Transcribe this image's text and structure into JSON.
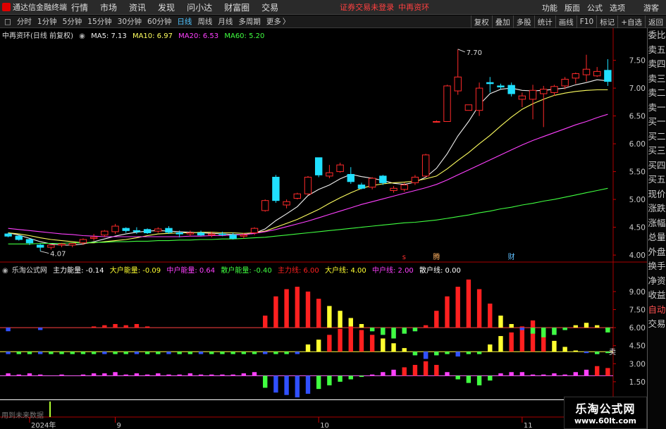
{
  "menubar": {
    "app_title": "通达信金融终端",
    "items": [
      "行情",
      "市场",
      "资讯",
      "发现",
      "问小达",
      "财富圈",
      "交易"
    ],
    "login_warning": "证券交易未登录",
    "stock_name": "中再资环",
    "right_items": [
      "功能",
      "版面",
      "公式",
      "选项"
    ],
    "user": "游客"
  },
  "tabs": {
    "left_glyph": "□",
    "items": [
      "分时",
      "1分钟",
      "5分钟",
      "15分钟",
      "30分钟",
      "60分钟",
      "日线",
      "周线",
      "月线",
      "多周期",
      "更多"
    ],
    "active": "日线",
    "more_glyph": "〉",
    "right_items": [
      "复权",
      "叠加",
      "多股",
      "统计",
      "画线",
      "F10",
      "标记",
      "+自选",
      "返回"
    ]
  },
  "sidebar": [
    "委比",
    "卖五",
    "卖四",
    "卖三",
    "卖二",
    "卖一",
    "买一",
    "买二",
    "买三",
    "买四",
    "买五",
    "现价",
    "涨跌",
    "涨幅",
    "总量",
    "外盘",
    "换手",
    "净资",
    "收益",
    "自动",
    "交易"
  ],
  "colors": {
    "up": "#ff2a2a",
    "down": "#20e0ff",
    "ma5": "#f0f0f0",
    "ma10": "#ffff60",
    "ma20": "#ff40ff",
    "ma60": "#40ff40",
    "main_force": "#ff2020",
    "big_house": "#ffff30",
    "mid_house": "#3050ff",
    "retail": "#40ff40"
  },
  "main_legend": {
    "title": "中再资环(日线 前复权)",
    "ma": [
      {
        "label": "MA5: 7.13",
        "color": "#f0f0f0"
      },
      {
        "label": "MA10: 6.97",
        "color": "#ffff60"
      },
      {
        "label": "MA20: 6.53",
        "color": "#ff40ff"
      },
      {
        "label": "MA60: 5.20",
        "color": "#40ff40"
      }
    ]
  },
  "ind_legend": {
    "title": "乐淘公式网",
    "items": [
      {
        "label": "主力能量: -0.14",
        "color": "#ffffff"
      },
      {
        "label": "大户能量: -0.09",
        "color": "#ffff30"
      },
      {
        "label": "中户能量: 0.64",
        "color": "#ff40ff"
      },
      {
        "label": "散户能量: -0.40",
        "color": "#40ff40"
      },
      {
        "label": "主力线: 6.00",
        "color": "#ff2020"
      },
      {
        "label": "大户线: 4.00",
        "color": "#ffff30"
      },
      {
        "label": "中户线: 2.00",
        "color": "#ff40ff"
      },
      {
        "label": "散户线: 0.00",
        "color": "#ffffff"
      }
    ]
  },
  "annotations": {
    "high": "7.70",
    "low": "4.07",
    "marker_s": "s",
    "marker_a": "腾",
    "marker_b": "财",
    "right_tag": "卖"
  },
  "footer_note": "用到未来数据",
  "watermark": {
    "name": "乐淘公式网",
    "url": "www.60lt.com"
  },
  "chart_data": [
    {
      "type": "candlestick",
      "name": "price",
      "ylim": [
        3.9,
        7.9
      ],
      "yticks": [
        4.0,
        4.5,
        5.0,
        5.5,
        6.0,
        6.5,
        7.0,
        7.5
      ],
      "x_labels": [
        "2024年",
        "9",
        "10",
        "11"
      ],
      "x_label_index": [
        2,
        10,
        29,
        48
      ],
      "candles": [
        [
          4.38,
          4.4,
          4.32,
          4.34
        ],
        [
          4.34,
          4.36,
          4.26,
          4.28
        ],
        [
          4.28,
          4.3,
          4.18,
          4.22
        ],
        [
          4.18,
          4.2,
          4.07,
          4.14
        ],
        [
          4.14,
          4.2,
          4.1,
          4.18
        ],
        [
          4.18,
          4.22,
          4.14,
          4.2
        ],
        [
          4.18,
          4.22,
          4.14,
          4.21
        ],
        [
          4.22,
          4.3,
          4.18,
          4.28
        ],
        [
          4.3,
          4.38,
          4.26,
          4.32
        ],
        [
          4.36,
          4.45,
          4.32,
          4.43
        ],
        [
          4.42,
          4.56,
          4.38,
          4.52
        ],
        [
          4.48,
          4.5,
          4.4,
          4.44
        ],
        [
          4.44,
          4.5,
          4.38,
          4.42
        ],
        [
          4.46,
          4.48,
          4.38,
          4.4
        ],
        [
          4.43,
          4.5,
          4.4,
          4.47
        ],
        [
          4.48,
          4.52,
          4.38,
          4.41
        ],
        [
          4.4,
          4.44,
          4.32,
          4.38
        ],
        [
          4.38,
          4.44,
          4.34,
          4.4
        ],
        [
          4.4,
          4.44,
          4.34,
          4.36
        ],
        [
          4.36,
          4.42,
          4.32,
          4.38
        ],
        [
          4.38,
          4.42,
          4.34,
          4.37
        ],
        [
          4.36,
          4.4,
          4.28,
          4.3
        ],
        [
          4.34,
          4.4,
          4.3,
          4.36
        ],
        [
          4.4,
          4.5,
          4.36,
          4.48
        ],
        [
          4.8,
          5.0,
          4.78,
          4.98
        ],
        [
          5.4,
          5.44,
          4.94,
          4.98
        ],
        [
          4.9,
          5.0,
          4.84,
          4.96
        ],
        [
          5.02,
          5.12,
          5.0,
          5.1
        ],
        [
          5.1,
          5.42,
          5.08,
          5.4
        ],
        [
          5.75,
          5.75,
          5.4,
          5.44
        ],
        [
          5.42,
          5.62,
          5.38,
          5.48
        ],
        [
          5.5,
          5.66,
          5.48,
          5.62
        ],
        [
          5.45,
          5.58,
          5.28,
          5.32
        ],
        [
          5.26,
          5.3,
          5.18,
          5.2
        ],
        [
          5.22,
          5.4,
          5.18,
          5.38
        ],
        [
          5.42,
          5.44,
          5.26,
          5.3
        ],
        [
          5.16,
          5.24,
          5.12,
          5.2
        ],
        [
          5.18,
          5.3,
          5.14,
          5.26
        ],
        [
          5.3,
          5.44,
          5.26,
          5.4
        ],
        [
          5.42,
          5.82,
          5.4,
          5.8
        ],
        [
          6.4,
          6.42,
          6.38,
          6.4
        ],
        [
          6.4,
          7.06,
          6.4,
          7.04
        ],
        [
          6.95,
          7.7,
          6.88,
          7.2
        ],
        [
          6.6,
          6.62,
          6.7,
          6.7
        ],
        [
          6.6,
          7.1,
          6.5,
          7.0
        ],
        [
          7.1,
          7.2,
          6.92,
          7.08
        ],
        [
          7.04,
          7.08,
          6.98,
          7.02
        ],
        [
          7.05,
          7.1,
          6.85,
          6.9
        ],
        [
          6.8,
          6.92,
          6.66,
          6.86
        ],
        [
          6.8,
          7.06,
          6.44,
          6.96
        ],
        [
          6.9,
          7.04,
          6.3,
          6.98
        ],
        [
          6.92,
          7.06,
          6.86,
          7.03
        ],
        [
          7.04,
          7.2,
          6.98,
          7.16
        ],
        [
          7.18,
          7.28,
          7.08,
          7.26
        ],
        [
          7.24,
          7.6,
          7.12,
          7.34
        ],
        [
          7.22,
          7.38,
          7.2,
          7.3
        ],
        [
          7.32,
          7.52,
          7.04,
          7.12
        ]
      ],
      "ma": {
        "ma5": [
          4.4,
          4.36,
          4.3,
          4.24,
          4.2,
          4.18,
          4.18,
          4.2,
          4.24,
          4.29,
          4.34,
          4.38,
          4.41,
          4.43,
          4.44,
          4.43,
          4.42,
          4.41,
          4.4,
          4.39,
          4.38,
          4.37,
          4.37,
          4.39,
          4.47,
          4.62,
          4.74,
          4.87,
          5.07,
          5.18,
          5.26,
          5.37,
          5.45,
          5.41,
          5.38,
          5.34,
          5.29,
          5.27,
          5.31,
          5.4,
          5.56,
          5.82,
          6.14,
          6.4,
          6.7,
          6.9,
          6.98,
          7.0,
          6.96,
          6.95,
          6.96,
          6.98,
          7.0,
          7.06,
          7.1,
          7.15,
          7.13
        ],
        "ma10": [
          4.4,
          4.38,
          4.35,
          4.31,
          4.28,
          4.26,
          4.24,
          4.22,
          4.22,
          4.24,
          4.26,
          4.28,
          4.31,
          4.35,
          4.38,
          4.39,
          4.4,
          4.4,
          4.41,
          4.41,
          4.4,
          4.4,
          4.39,
          4.4,
          4.43,
          4.5,
          4.57,
          4.64,
          4.73,
          4.82,
          4.93,
          5.03,
          5.12,
          5.2,
          5.25,
          5.28,
          5.3,
          5.31,
          5.33,
          5.37,
          5.42,
          5.55,
          5.7,
          5.84,
          6.0,
          6.15,
          6.32,
          6.48,
          6.62,
          6.72,
          6.8,
          6.87,
          6.91,
          6.94,
          6.96,
          6.97,
          6.97
        ],
        "ma20": [
          4.48,
          4.46,
          4.44,
          4.42,
          4.4,
          4.38,
          4.37,
          4.35,
          4.34,
          4.33,
          4.33,
          4.33,
          4.33,
          4.33,
          4.33,
          4.33,
          4.33,
          4.34,
          4.34,
          4.35,
          4.35,
          4.36,
          4.37,
          4.39,
          4.42,
          4.46,
          4.51,
          4.56,
          4.61,
          4.67,
          4.73,
          4.79,
          4.85,
          4.91,
          4.96,
          5.01,
          5.06,
          5.11,
          5.16,
          5.21,
          5.27,
          5.35,
          5.44,
          5.53,
          5.62,
          5.71,
          5.8,
          5.89,
          5.98,
          6.06,
          6.13,
          6.2,
          6.27,
          6.34,
          6.4,
          6.47,
          6.53
        ],
        "ma60": [
          4.2,
          4.2,
          4.2,
          4.21,
          4.21,
          4.21,
          4.22,
          4.22,
          4.23,
          4.23,
          4.24,
          4.24,
          4.25,
          4.25,
          4.26,
          4.26,
          4.27,
          4.27,
          4.28,
          4.28,
          4.29,
          4.29,
          4.3,
          4.31,
          4.32,
          4.34,
          4.36,
          4.38,
          4.4,
          4.42,
          4.44,
          4.46,
          4.48,
          4.5,
          4.52,
          4.54,
          4.56,
          4.58,
          4.59,
          4.61,
          4.63,
          4.66,
          4.69,
          4.72,
          4.76,
          4.79,
          4.83,
          4.86,
          4.9,
          4.93,
          4.97,
          5.0,
          5.04,
          5.08,
          5.12,
          5.16,
          5.2
        ]
      }
    },
    {
      "type": "bar",
      "name": "indicator",
      "ylim": [
        -1.2,
        10.4
      ],
      "yticks": [
        9.0,
        7.5,
        6.0,
        4.5,
        3.0,
        1.5
      ],
      "baselines": [
        {
          "value": 6,
          "color": "#ff4040"
        },
        {
          "value": 4,
          "color": "#ffff40"
        },
        {
          "value": 2,
          "color": "#ff60ff"
        },
        {
          "value": 0,
          "color": "#ffffff"
        }
      ],
      "series": [
        {
          "name": "主力能量",
          "baseline": 6,
          "values": [
            0,
            0,
            0,
            0,
            0,
            0,
            0,
            0,
            0.1,
            0.2,
            0.3,
            0.2,
            0.3,
            0.1,
            0,
            0,
            0,
            0,
            0,
            0,
            0,
            0,
            0,
            0,
            1.0,
            2.6,
            3.2,
            3.4,
            3.0,
            2.4,
            1.8,
            1.4,
            0.8,
            0.3,
            -0.3,
            -0.6,
            -0.9,
            -0.5,
            -0.3,
            0.2,
            1.4,
            2.6,
            3.4,
            4.0,
            3.2,
            2.0,
            1.0,
            0.3,
            -0.2,
            -0.5,
            -0.8,
            -0.6,
            -0.2,
            0.2,
            0.4,
            0.2,
            -0.14
          ]
        },
        {
          "name": "大户能量",
          "baseline": 4,
          "values": [
            0,
            0,
            0,
            0,
            0,
            0,
            0,
            0,
            0,
            0,
            0,
            0,
            0,
            0,
            0,
            0,
            0,
            0,
            0,
            0,
            0,
            0,
            0,
            0,
            0,
            0,
            0,
            0,
            0.6,
            1.0,
            1.4,
            1.9,
            2.1,
            1.8,
            1.4,
            1.1,
            0.7,
            0.3,
            -0.3,
            -0.6,
            -0.3,
            0,
            0,
            0,
            0,
            0.6,
            1.3,
            1.6,
            2.1,
            2.6,
            1.8,
            0.9,
            0.4,
            0.1,
            -0.1,
            -0.2,
            -0.09
          ]
        },
        {
          "name": "中户能量",
          "baseline": 2,
          "values": [
            0.2,
            0.1,
            0.2,
            0.1,
            0,
            0.1,
            0,
            0.1,
            0.2,
            0.2,
            0.3,
            0.1,
            0.2,
            0.1,
            0.2,
            0.1,
            0.1,
            0.2,
            0.1,
            0.1,
            0.1,
            0.1,
            0.2,
            0.3,
            -1.0,
            -1.4,
            -1.6,
            -1.8,
            -1.5,
            -1.1,
            -0.8,
            -0.5,
            -0.3,
            -0.1,
            0.1,
            0.3,
            0.5,
            0.7,
            0.9,
            1.2,
            0.9,
            0.3,
            -0.3,
            -0.6,
            -0.8,
            -0.4,
            0.2,
            0.3,
            0.3,
            0.1,
            0.1,
            0.2,
            0.1,
            0.3,
            0.5,
            0.8,
            0.64
          ]
        },
        {
          "name": "散户能量",
          "baseline": 6,
          "values": [
            0,
            0,
            0,
            0,
            0,
            0,
            0,
            0,
            0,
            0,
            0,
            0,
            0,
            0,
            0,
            0,
            0,
            0,
            0,
            0,
            0,
            0,
            0,
            0,
            0,
            0,
            0,
            0,
            0,
            0,
            0,
            0,
            0,
            0,
            0,
            0,
            0,
            0,
            0,
            0,
            0,
            0,
            0,
            0,
            0,
            0,
            0,
            0,
            0,
            0,
            0,
            0,
            0,
            0,
            0,
            0,
            -0.4
          ]
        }
      ],
      "baseline_marks": [
        {
          "baseline": 6,
          "values": [
            -0.3,
            0,
            0,
            -0.2,
            0,
            0,
            0,
            0,
            0,
            0,
            0,
            0,
            0,
            0,
            0,
            0,
            0,
            0,
            0,
            0,
            0,
            0,
            0,
            0,
            0,
            0,
            0,
            0,
            0,
            0,
            0,
            0,
            0,
            0,
            -0.3,
            -0.6,
            -0.9,
            -0.5,
            -0.3,
            0,
            0,
            0,
            0,
            0,
            0,
            0,
            0,
            0,
            -0.2,
            -0.5,
            -0.8,
            -0.6,
            -0.2,
            0,
            0,
            0,
            -0.14
          ]
        },
        {
          "baseline": 4,
          "values": [
            -0.2,
            -0.2,
            -0.2,
            -0.2,
            -0.2,
            -0.2,
            -0.2,
            -0.2,
            -0.2,
            -0.2,
            -0.2,
            -0.2,
            -0.2,
            -0.2,
            -0.2,
            -0.2,
            -0.2,
            -0.2,
            -0.2,
            -0.2,
            -0.2,
            -0.2,
            -0.2,
            -0.2,
            -0.2,
            -0.2,
            -0.2,
            -0.2,
            0,
            0,
            0,
            0,
            0,
            0,
            0,
            0,
            0,
            0,
            -0.3,
            -0.6,
            -0.3,
            -0.2,
            -0.4,
            -0.2,
            -0.2,
            0,
            0,
            0,
            0,
            0,
            0,
            0,
            0,
            0,
            -0.1,
            -0.2,
            -0.09
          ]
        }
      ]
    }
  ]
}
